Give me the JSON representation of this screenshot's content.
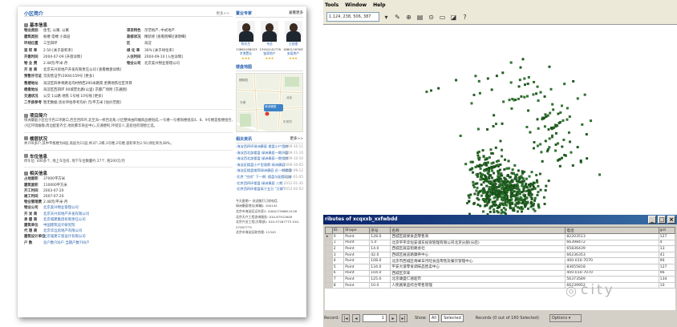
{
  "web": {
    "title": "小区简介",
    "more": "更多>>",
    "basic": {
      "heading": "基本信息",
      "rows": [
        [
          {
            "k": "物业类别",
            "v": "住宅, 公寓, 公寓"
          },
          {
            "k": "项目特色",
            "v": "示范地产, 中式地产"
          }
        ],
        [
          {
            "k": "建筑类别",
            "v": "板楼 塔楼 小高层"
          },
          {
            "k": "装修状况",
            "v": "精装修 [查看明细][请明细]"
          }
        ],
        [
          {
            "k": "环线位置",
            "v": "三至四环"
          },
          {
            "k": "区",
            "v": "海淀"
          }
        ],
        [
          {
            "k": "容 积 率",
            "v": "2.50 [关于容积率]"
          },
          {
            "k": "绿 化 率",
            "v": "30% [关于绿化率]"
          }
        ],
        [
          {
            "k": "开盘时间",
            "v": "2004-07-09 [开盘详情]"
          },
          {
            "k": "入住时间",
            "v": "2004-09-10 [入住详情]"
          }
        ],
        [
          {
            "k": "物 业 费",
            "v": "2.48元/平米·月"
          },
          {
            "k": "物业公司",
            "v": "北京美兴物业管理公司"
          }
        ],
        [
          {
            "k": "开 发 商",
            "v": "北京天兴房地产开发有限责任公司 [查看楼盘详情]"
          }
        ],
        [
          {
            "k": "预售许可证",
            "v": "京房售证字(2004)159号 [更多]"
          }
        ],
        [
          {
            "k": "售楼地址",
            "v": "海淀区四季青路北坞村桥西200米路南 金隅地铁社区项目"
          }
        ],
        [
          {
            "k": "楼盘地址",
            "v": "海淀区西四环 00城堡北路(公里) 京都广场附 [交通图]"
          }
        ],
        [
          {
            "k": "交通状况",
            "v": "公交 1公路 地铁 1号线 10号线 [更多]"
          }
        ],
        [
          {
            "k": "二手房参考",
            "v": "暂无数据 房价评估参考均价 元/平方米 [估价范围]"
          }
        ]
      ]
    },
    "project": {
      "heading": "项目简介",
      "text": "绿洲康庭小区位于西三环路口,西至西四环,北至海一桥西北角,小区整体由四幢商品楼组成,一号楼一号楼商楼组成4、8、9号楼是板楼组合,小区环境幽静,周边配套齐全,地处繁华商业中心,交通便利,环境宜人,是居住的理想之选。"
    },
    "building": {
      "heading": "楼层状况",
      "text": "共700多户,其中平板楼为8层,高层为11层,共3户,2梯,1号楼,2号楼,容积率为2.50,绿化率为38%。"
    },
    "parking": {
      "heading": "车位信息",
      "text": "停车位: 400多个, 地上车位有, 地下车位数量约 27个, 租200元/月"
    },
    "related": {
      "heading": "相关信息",
      "rows": [
        {
          "k": "占地面积",
          "v": "37000平方米"
        },
        {
          "k": "建筑面积",
          "v": "110000平方米"
        },
        {
          "k": "开工时间",
          "v": "2003-07-20"
        },
        {
          "k": "竣工时间",
          "v": "2007-07-20"
        },
        {
          "k": "物业管理费",
          "v": "2.48元/平米·月"
        },
        {
          "k": "物业公司",
          "v": "北京美兴物业管理公司"
        },
        {
          "k": "开 发 商",
          "v": "北京天兴房地产开发有限公司"
        },
        {
          "k": "承 建 商",
          "v": "北京城建集团有限责任公司"
        },
        {
          "k": "建筑单位",
          "v": "中国建筑设计研究院"
        },
        {
          "k": "代 理 商",
          "v": "北京华远房地产有限公司"
        },
        {
          "k": "建筑设计单位",
          "v": "北京城建工程设计有限公司"
        },
        {
          "k": "户 数",
          "v": "总户数700户 当期户数700户"
        }
      ]
    },
    "agents_heading": "置业专家",
    "agents_more": "查看更多",
    "agents": [
      {
        "name": "陈先生",
        "phone": "13661058023",
        "shop": "京港置业"
      },
      {
        "name": "韦总",
        "phone": "13910142776",
        "shop": "链家地产"
      },
      {
        "name": "王经理",
        "phone": "18801167633",
        "shop": "安居房产"
      }
    ],
    "map_heading": "楼盘地图",
    "map_labels": [
      "颐和园",
      "北京",
      "绿洲康庭",
      "万柳",
      "中关村"
    ],
    "news_heading": "相关资讯",
    "news_more": "更多>>",
    "news": [
      {
        "t": "·海淀西四环绿洲康庭 楼盘小户型房",
        "d": "2009-10-11"
      },
      {
        "t": "·海淀西北部楼盘 绿洲康庭一期开盘",
        "d": "2009-11-10"
      },
      {
        "t": "·海淀西北部楼盘 绿洲康庭一期交房",
        "d": "2009-10-10"
      },
      {
        "t": "·海淀区楼盘小户型观察 绿洲康庭",
        "d": "2009-10-05"
      },
      {
        "t": "·海淀区楼盘推荐绿洲康庭 近一期楼盘",
        "d": "2009-09-12"
      },
      {
        "t": "·北京 \"空间\" 下一期: 楼盘与配套设施",
        "d": "2012-01-05"
      },
      {
        "t": "·北京西四环楼盘 绿洲康庭 二期",
        "d": "2012-01-30"
      },
      {
        "t": "·北京西四环楼盘高于五万 \"万柳\"",
        "d": "2012-02-03"
      }
    ],
    "contact": [
      "今天星期一 欢迎拨打订房电话",
      "绿洲康庭地址(邮编): 100142",
      "北京市海淀区远东家2: 4000175688-5126",
      "北京天兴工程咨询服务: 010-87912648",
      "北京兴业工程(方联部): 010-57267775 010-57287775",
      "北京市海淀区联合楼: 12345"
    ]
  },
  "gis": {
    "menus": [
      "Tools",
      "Window",
      "Help"
    ],
    "coord": "1.124, 238, 506, 387",
    "table_title": "ributes of xcqxxb_xxfwbdd",
    "columns": [
      "ID",
      "Shape",
      "序号",
      "名称",
      "电话",
      "gid"
    ],
    "rows": [
      [
        "0",
        "Point",
        "128.0",
        "西城区蔬果食品零售商",
        "82203513",
        "127"
      ],
      [
        "1",
        "Point",
        "5.0",
        "北京平平华恒安浦东投资管理有限公司北京分部(分店)",
        "66398472",
        "4"
      ],
      [
        "2",
        "Point",
        "14.0",
        "西城区蔬菜街路会社",
        "65836439",
        "13"
      ],
      [
        "3",
        "Point",
        "42.0",
        "西城区展览路康养中心",
        "66236353",
        "41"
      ],
      [
        "4",
        "Point",
        "108.0",
        "北京市西城区奇峰日月旺食品零售及餐饮管理中心",
        "400-010-7070",
        "96"
      ],
      [
        "5",
        "Point",
        "134.0",
        "平安大道零食调味品售卖中心",
        "83655818",
        "127"
      ],
      [
        "6",
        "Point",
        "104.0",
        "西城区京味",
        "400-010-7070",
        "96"
      ],
      [
        "7",
        "Point",
        "125.0",
        "北京康盛仁德超市",
        "56373589",
        "134"
      ],
      [
        "8",
        "Point",
        "10.0",
        "人民路果品综合零售管理",
        "66239952",
        "10"
      ]
    ],
    "status": {
      "record_label": "Record:",
      "record_value": "1",
      "show_label": "Show:",
      "all": "All",
      "selected": "Selected",
      "records_text": "Records (0 out of 160 Selected)",
      "options": "Options"
    }
  },
  "watermark": "city"
}
